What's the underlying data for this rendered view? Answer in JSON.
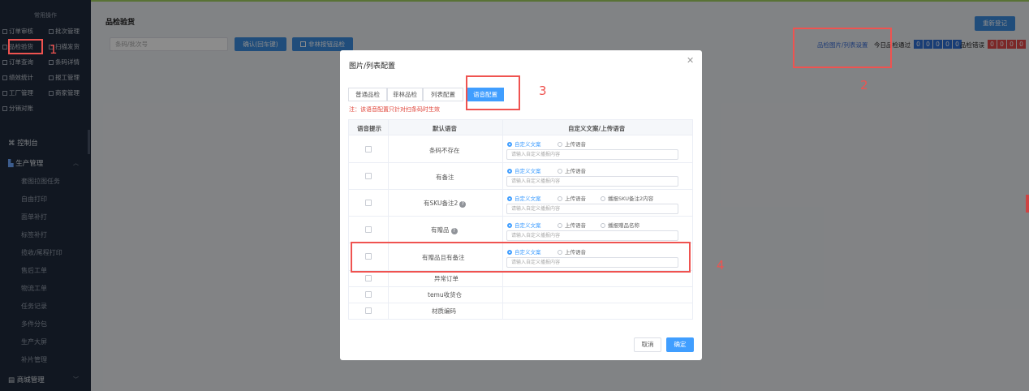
{
  "sidebar": {
    "quick_title": "常用操作",
    "quick_items": [
      "订单审核",
      "批次管理",
      "品检验货",
      "扫描发货",
      "订单查询",
      "条码详情",
      "绩效统计",
      "报工管理",
      "工厂管理",
      "商家管理",
      "分销对账"
    ],
    "dashboard": "控制台",
    "production": "生产管理",
    "production_items": [
      "套图拉图任务",
      "自由打印",
      "面单补打",
      "标签补打",
      "揽收/尾程打印",
      "售后工单",
      "物流工单",
      "任务记录",
      "多件分包",
      "生产大屏",
      "补片管理"
    ],
    "mall": "商城管理"
  },
  "page": {
    "title": "品检验货",
    "scan_placeholder": "条码/批次号",
    "confirm_button": "确认(回车键)",
    "batch_checkbox": "非林按钮品检",
    "reregister_button": "重新登记",
    "settings_link": "品检图片/列表设置",
    "today_pass_label": "今日品检通过",
    "today_pass_digits": [
      "0",
      "0",
      "0",
      "0",
      "0"
    ],
    "error_label": "品检错误",
    "error_digits": [
      "0",
      "0",
      "0",
      "0",
      "0"
    ]
  },
  "modal": {
    "title": "图片/列表配置",
    "tabs": [
      "普通品检",
      "菲林品检",
      "列表配置",
      "语音配置"
    ],
    "active_tab": 3,
    "note": "注：该语音配置只针对扫条码时生效",
    "headers": [
      "语音提示",
      "默认语音",
      "自定义文案/上传语音"
    ],
    "radio_custom": "自定义文案",
    "radio_upload": "上传语音",
    "input_placeholder": "请输入自定义播报内容",
    "rows": [
      {
        "label": "条码不存在",
        "help": false,
        "extra": ""
      },
      {
        "label": "有备注",
        "help": false,
        "extra": ""
      },
      {
        "label": "有SKU备注2",
        "help": true,
        "extra": "播报SKU备注2内容"
      },
      {
        "label": "有赠品",
        "help": true,
        "extra": "播报赠品名称"
      },
      {
        "label": "有赠品且有备注",
        "help": false,
        "extra": ""
      },
      {
        "label": "异常订单",
        "help": false,
        "extra": ""
      },
      {
        "label": "temu收货仓",
        "help": false,
        "extra": ""
      },
      {
        "label": "材质编码",
        "help": false,
        "extra": ""
      }
    ],
    "cancel_button": "取消",
    "ok_button": "确定"
  },
  "annotations": [
    "1",
    "2",
    "3",
    "4"
  ],
  "colors": {
    "accent": "#409eff",
    "sidebar": "#1f2a3c",
    "highlight": "#ef5350"
  }
}
